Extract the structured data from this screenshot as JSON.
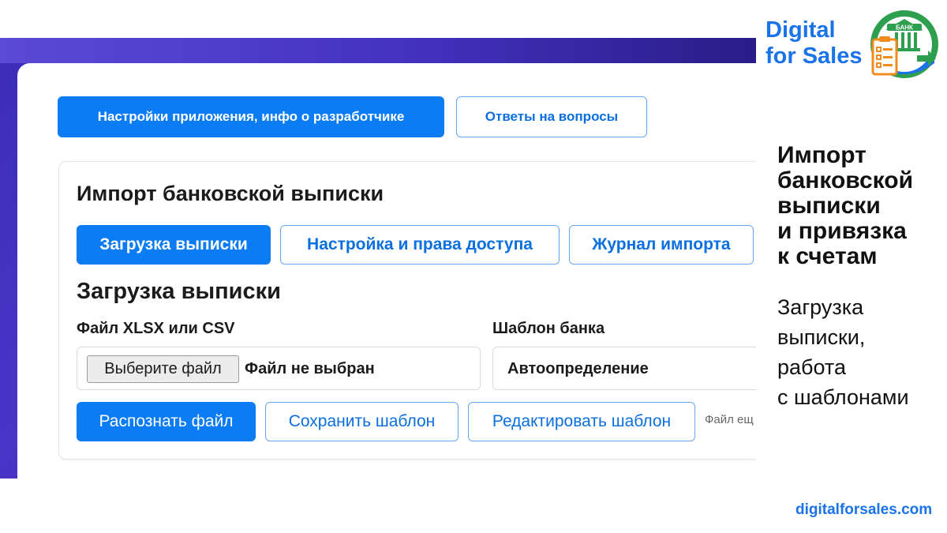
{
  "app": {
    "top_buttons": {
      "settings": "Настройки приложения, инфо о разработчике",
      "faq": "Ответы на вопросы"
    },
    "card": {
      "title": "Импорт банковской выписки",
      "tabs": [
        {
          "label": "Загрузка выписки",
          "active": true
        },
        {
          "label": "Настройка и права доступа",
          "active": false
        },
        {
          "label": "Журнал импорта",
          "active": false
        }
      ],
      "section_title": "Загрузка выписки",
      "file_field": {
        "label": "Файл XLSX или CSV",
        "button": "Выберите файл",
        "status": "Файл не выбран"
      },
      "template_field": {
        "label": "Шаблон банка",
        "value": "Автоопределение"
      },
      "actions": {
        "recognize": "Распознать файл",
        "save_template": "Сохранить шаблон",
        "edit_template": "Редактировать шаблон",
        "hint": "Файл ещ"
      }
    }
  },
  "branding": {
    "name_line1": "Digital",
    "name_line2": "for Sales",
    "logo_label": "БАНК",
    "website": "digitalforsales.com",
    "colors": {
      "brand_blue": "#1a73e8",
      "logo_green": "#2e9e4f",
      "logo_orange": "#f08c1e",
      "accent": "#0b7cf4"
    }
  },
  "slide": {
    "title_lines": [
      "Импорт",
      "банковской",
      "выписки",
      "и привязка",
      "к счетам"
    ],
    "subtitle_lines": [
      "Загрузка",
      "выписки,",
      "работа",
      "с шаблонами"
    ]
  }
}
